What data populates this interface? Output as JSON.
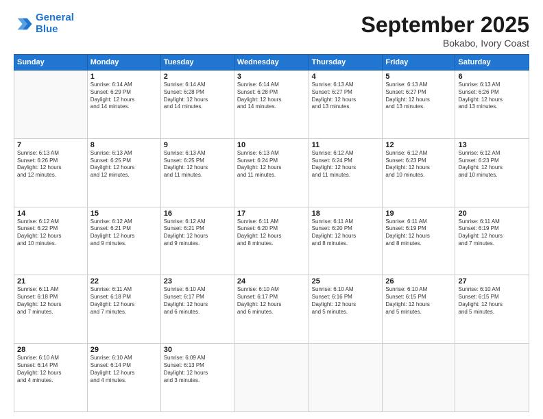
{
  "logo": {
    "line1": "General",
    "line2": "Blue"
  },
  "title": "September 2025",
  "subtitle": "Bokabo, Ivory Coast",
  "days_header": [
    "Sunday",
    "Monday",
    "Tuesday",
    "Wednesday",
    "Thursday",
    "Friday",
    "Saturday"
  ],
  "weeks": [
    [
      {
        "day": "",
        "info": ""
      },
      {
        "day": "1",
        "info": "Sunrise: 6:14 AM\nSunset: 6:29 PM\nDaylight: 12 hours\nand 14 minutes."
      },
      {
        "day": "2",
        "info": "Sunrise: 6:14 AM\nSunset: 6:28 PM\nDaylight: 12 hours\nand 14 minutes."
      },
      {
        "day": "3",
        "info": "Sunrise: 6:14 AM\nSunset: 6:28 PM\nDaylight: 12 hours\nand 14 minutes."
      },
      {
        "day": "4",
        "info": "Sunrise: 6:13 AM\nSunset: 6:27 PM\nDaylight: 12 hours\nand 13 minutes."
      },
      {
        "day": "5",
        "info": "Sunrise: 6:13 AM\nSunset: 6:27 PM\nDaylight: 12 hours\nand 13 minutes."
      },
      {
        "day": "6",
        "info": "Sunrise: 6:13 AM\nSunset: 6:26 PM\nDaylight: 12 hours\nand 13 minutes."
      }
    ],
    [
      {
        "day": "7",
        "info": "Sunrise: 6:13 AM\nSunset: 6:26 PM\nDaylight: 12 hours\nand 12 minutes."
      },
      {
        "day": "8",
        "info": "Sunrise: 6:13 AM\nSunset: 6:25 PM\nDaylight: 12 hours\nand 12 minutes."
      },
      {
        "day": "9",
        "info": "Sunrise: 6:13 AM\nSunset: 6:25 PM\nDaylight: 12 hours\nand 11 minutes."
      },
      {
        "day": "10",
        "info": "Sunrise: 6:13 AM\nSunset: 6:24 PM\nDaylight: 12 hours\nand 11 minutes."
      },
      {
        "day": "11",
        "info": "Sunrise: 6:12 AM\nSunset: 6:24 PM\nDaylight: 12 hours\nand 11 minutes."
      },
      {
        "day": "12",
        "info": "Sunrise: 6:12 AM\nSunset: 6:23 PM\nDaylight: 12 hours\nand 10 minutes."
      },
      {
        "day": "13",
        "info": "Sunrise: 6:12 AM\nSunset: 6:23 PM\nDaylight: 12 hours\nand 10 minutes."
      }
    ],
    [
      {
        "day": "14",
        "info": "Sunrise: 6:12 AM\nSunset: 6:22 PM\nDaylight: 12 hours\nand 10 minutes."
      },
      {
        "day": "15",
        "info": "Sunrise: 6:12 AM\nSunset: 6:21 PM\nDaylight: 12 hours\nand 9 minutes."
      },
      {
        "day": "16",
        "info": "Sunrise: 6:12 AM\nSunset: 6:21 PM\nDaylight: 12 hours\nand 9 minutes."
      },
      {
        "day": "17",
        "info": "Sunrise: 6:11 AM\nSunset: 6:20 PM\nDaylight: 12 hours\nand 8 minutes."
      },
      {
        "day": "18",
        "info": "Sunrise: 6:11 AM\nSunset: 6:20 PM\nDaylight: 12 hours\nand 8 minutes."
      },
      {
        "day": "19",
        "info": "Sunrise: 6:11 AM\nSunset: 6:19 PM\nDaylight: 12 hours\nand 8 minutes."
      },
      {
        "day": "20",
        "info": "Sunrise: 6:11 AM\nSunset: 6:19 PM\nDaylight: 12 hours\nand 7 minutes."
      }
    ],
    [
      {
        "day": "21",
        "info": "Sunrise: 6:11 AM\nSunset: 6:18 PM\nDaylight: 12 hours\nand 7 minutes."
      },
      {
        "day": "22",
        "info": "Sunrise: 6:11 AM\nSunset: 6:18 PM\nDaylight: 12 hours\nand 7 minutes."
      },
      {
        "day": "23",
        "info": "Sunrise: 6:10 AM\nSunset: 6:17 PM\nDaylight: 12 hours\nand 6 minutes."
      },
      {
        "day": "24",
        "info": "Sunrise: 6:10 AM\nSunset: 6:17 PM\nDaylight: 12 hours\nand 6 minutes."
      },
      {
        "day": "25",
        "info": "Sunrise: 6:10 AM\nSunset: 6:16 PM\nDaylight: 12 hours\nand 5 minutes."
      },
      {
        "day": "26",
        "info": "Sunrise: 6:10 AM\nSunset: 6:15 PM\nDaylight: 12 hours\nand 5 minutes."
      },
      {
        "day": "27",
        "info": "Sunrise: 6:10 AM\nSunset: 6:15 PM\nDaylight: 12 hours\nand 5 minutes."
      }
    ],
    [
      {
        "day": "28",
        "info": "Sunrise: 6:10 AM\nSunset: 6:14 PM\nDaylight: 12 hours\nand 4 minutes."
      },
      {
        "day": "29",
        "info": "Sunrise: 6:10 AM\nSunset: 6:14 PM\nDaylight: 12 hours\nand 4 minutes."
      },
      {
        "day": "30",
        "info": "Sunrise: 6:09 AM\nSunset: 6:13 PM\nDaylight: 12 hours\nand 3 minutes."
      },
      {
        "day": "",
        "info": ""
      },
      {
        "day": "",
        "info": ""
      },
      {
        "day": "",
        "info": ""
      },
      {
        "day": "",
        "info": ""
      }
    ]
  ]
}
